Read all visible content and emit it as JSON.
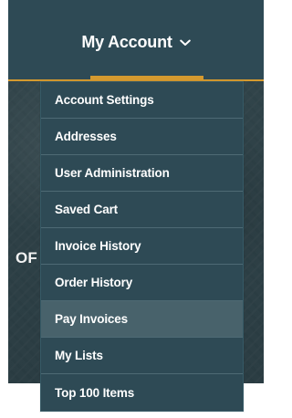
{
  "header": {
    "account_label": "My Account"
  },
  "hero": {
    "partial_text": "OF T"
  },
  "menu": {
    "items": [
      "Account Settings",
      "Addresses",
      "User Administration",
      "Saved Cart",
      "Invoice History",
      "Order History",
      "Pay Invoices",
      "My Lists",
      "Top 100 Items"
    ],
    "active_index": 6
  },
  "icons": {
    "account_dropdown": "chevron-down-icon"
  },
  "colors": {
    "header_bg": "#2e4a55",
    "menu_bg": "#2e4a55",
    "menu_active_bg": "#48626b",
    "accent": "#d59a2f",
    "text": "#ffffff"
  }
}
